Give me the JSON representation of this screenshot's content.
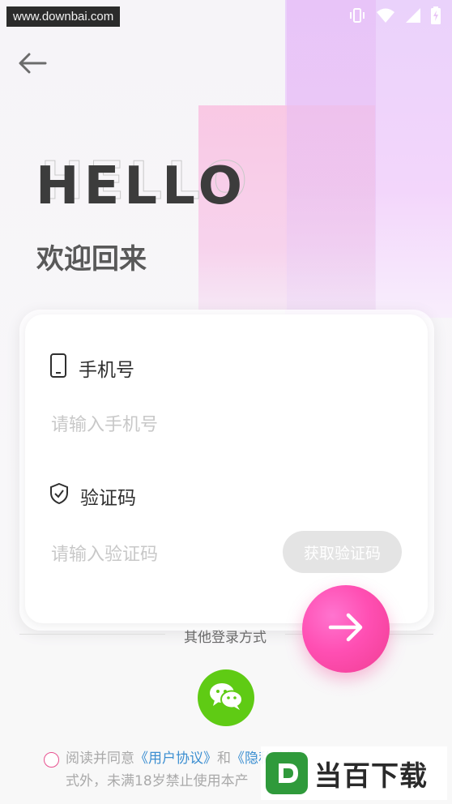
{
  "watermark": {
    "text": "www.downbai.com"
  },
  "header": {
    "hello": "HELLO",
    "welcome": "欢迎回来"
  },
  "form": {
    "phone_label": "手机号",
    "phone_placeholder": "请输入手机号",
    "code_label": "验证码",
    "code_placeholder": "请输入验证码",
    "get_code_label": "获取验证码"
  },
  "other_login": {
    "label": "其他登录方式"
  },
  "agreement": {
    "prefix": "阅读并同意",
    "user_agreement": "《用户协议》",
    "and": "和",
    "privacy_policy_partial": "《隐私政策》",
    "line2": "式外，未满18岁禁止使用本产"
  },
  "brand_overlay": {
    "text": "当百下载"
  },
  "colors": {
    "accent_pink": "#f03d92",
    "wechat_green": "#5fcb14",
    "link_blue": "#3c8fd1",
    "placeholder_gray": "#c8c8c8"
  },
  "icons": {
    "back": "arrow-left-icon",
    "phone": "mobile-phone-icon",
    "code": "shield-check-icon",
    "submit": "arrow-right-icon",
    "wechat": "wechat-icon",
    "status": [
      "vibrate-icon",
      "wifi-icon",
      "signal-icon",
      "battery-icon"
    ]
  }
}
